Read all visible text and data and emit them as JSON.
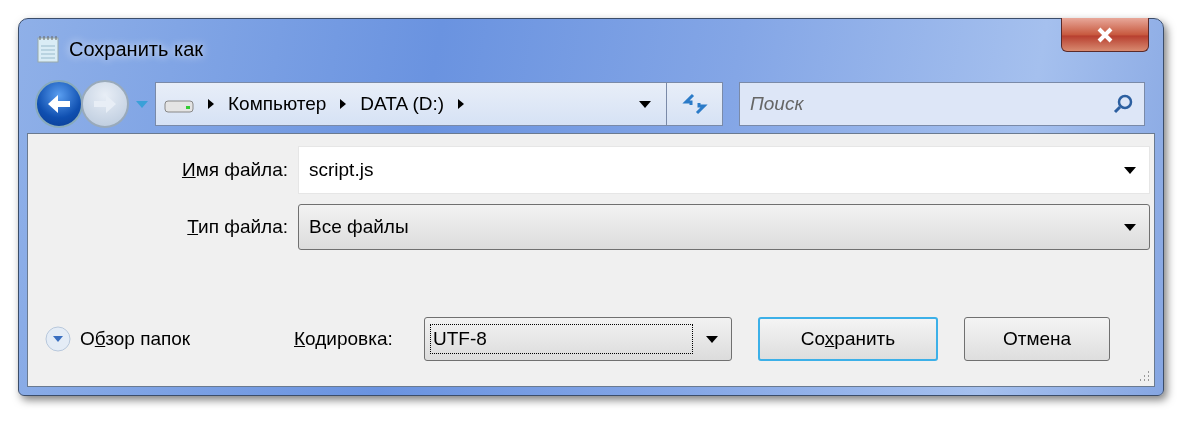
{
  "window": {
    "title": "Сохранить как"
  },
  "navigation": {
    "breadcrumbs": [
      "Компьютер",
      "DATA (D:)"
    ]
  },
  "search": {
    "placeholder": "Поиск"
  },
  "fields": [
    {
      "label": [
        {
          "text": "И",
          "underlined": true
        },
        {
          "text": "мя файла:",
          "underlined": false
        }
      ],
      "value": "script.js",
      "kind": "editable"
    },
    {
      "label": [
        {
          "text": "Т",
          "underlined": true
        },
        {
          "text": "ип файла:",
          "underlined": false
        }
      ],
      "value": "Все файлы",
      "kind": "dropdown"
    }
  ],
  "browse_folders": {
    "label": [
      {
        "text": "О",
        "underlined": false
      },
      {
        "text": "б",
        "underlined": true
      },
      {
        "text": "зор папок",
        "underlined": false
      }
    ],
    "expanded": false
  },
  "encoding": {
    "label": [
      {
        "text": "К",
        "underlined": true
      },
      {
        "text": "одировка:",
        "underlined": false
      }
    ],
    "value": "UTF-8",
    "focused": true
  },
  "buttons": [
    {
      "label": [
        {
          "text": "Со",
          "underlined": false
        },
        {
          "text": "х",
          "underlined": true
        },
        {
          "text": "ранить",
          "underlined": false
        }
      ],
      "default": true
    },
    {
      "label": [
        {
          "text": "Отмена",
          "underlined": false
        }
      ],
      "default": false
    }
  ]
}
